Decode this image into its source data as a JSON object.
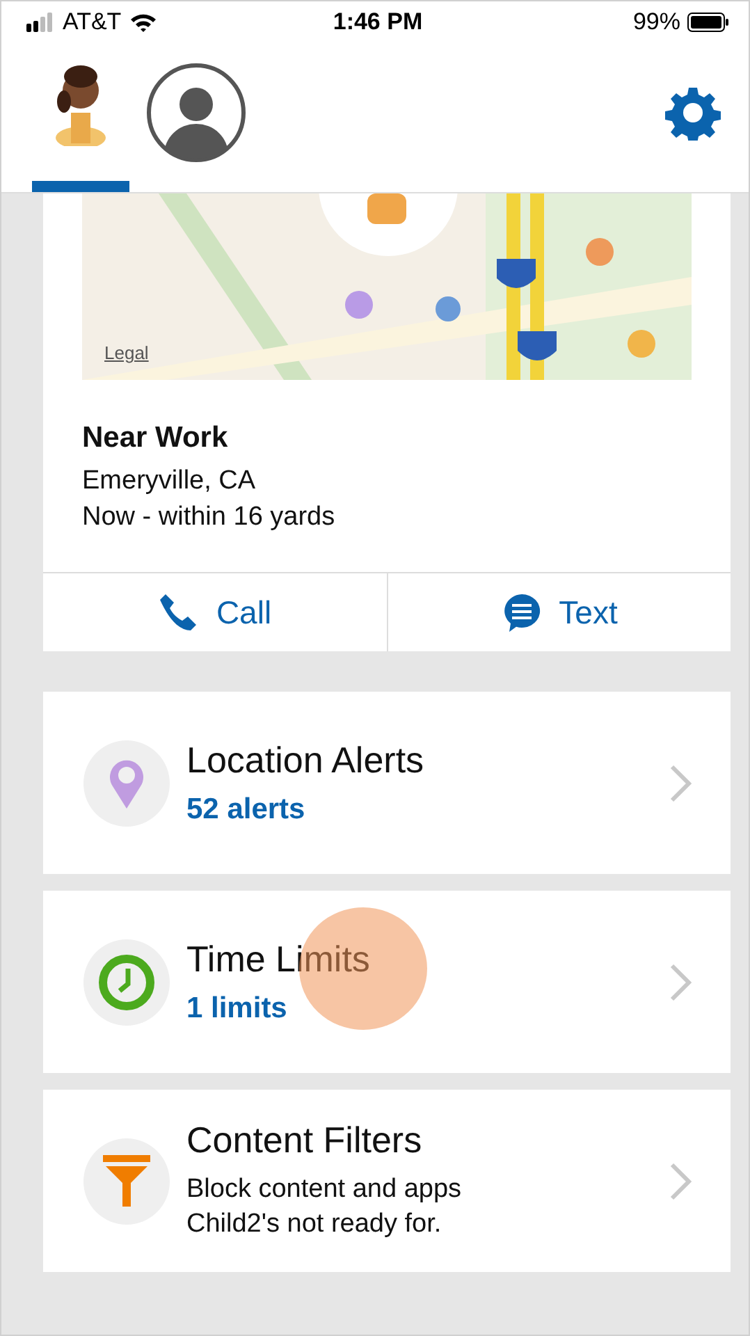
{
  "status_bar": {
    "carrier": "AT&T",
    "time": "1:46 PM",
    "battery": "99%"
  },
  "profiles": [
    {
      "kind": "child",
      "selected": true
    },
    {
      "kind": "placeholder",
      "selected": false
    }
  ],
  "location": {
    "map_link": "Legal",
    "place": "Near Work",
    "city": "Emeryville, CA",
    "accuracy": "Now - within 16 yards",
    "actions": [
      {
        "kind": "call",
        "label": "Call"
      },
      {
        "kind": "text",
        "label": "Text"
      }
    ]
  },
  "features": [
    {
      "kind": "location",
      "title": "Location Alerts",
      "subtitle": {
        "kind": "count",
        "text": "52 alerts"
      },
      "touched": false
    },
    {
      "kind": "time",
      "title": "Time Limits",
      "subtitle": {
        "kind": "count",
        "text": "1 limits"
      },
      "touched": true
    },
    {
      "kind": "filter",
      "title": "Content Filters",
      "subtitle": {
        "kind": "description",
        "text": "Block content and apps Child2's not ready for."
      },
      "touched": false
    }
  ]
}
